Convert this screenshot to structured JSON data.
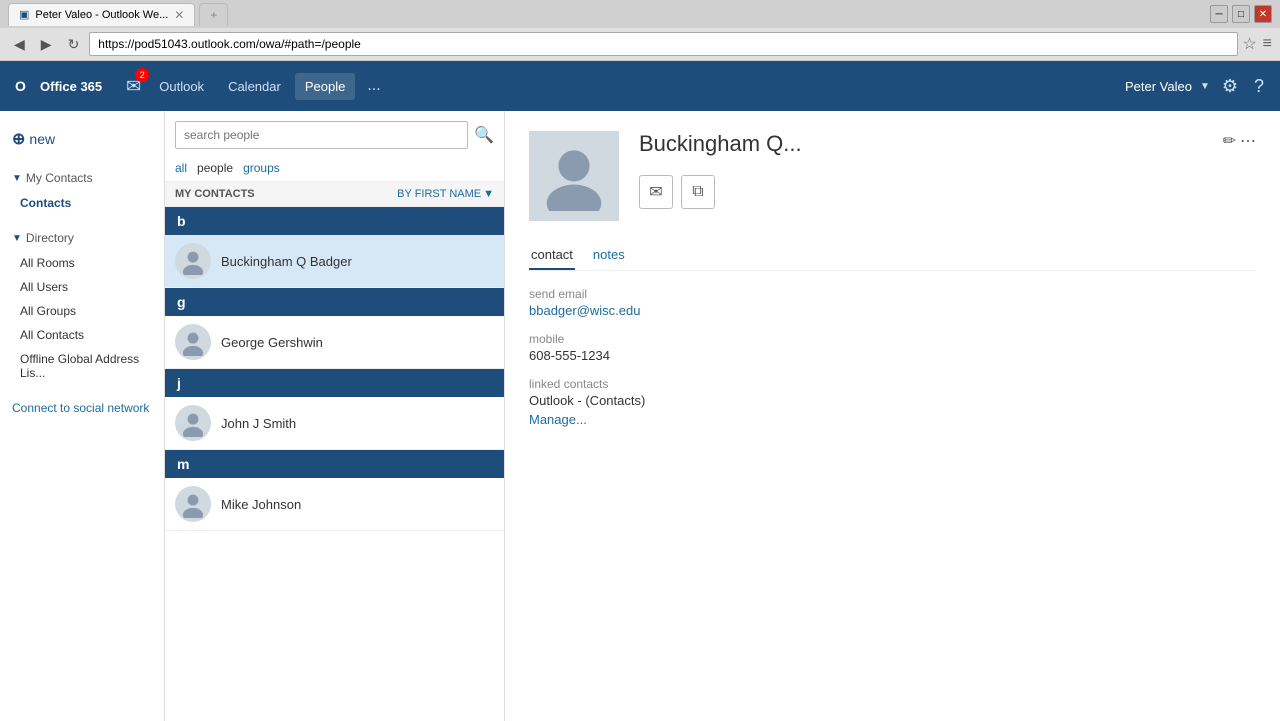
{
  "browser": {
    "tab_active": "Peter Valeo - Outlook We...",
    "tab_inactive": "",
    "address": "https://pod51043.outlook.com/owa/#path=/people",
    "back": "◀",
    "forward": "▶",
    "refresh": "↻"
  },
  "app": {
    "logo": "Office 365",
    "nav_items": [
      "Outlook",
      "Calendar",
      "People",
      "..."
    ],
    "user": "Peter Valeo",
    "mail_badge": "2"
  },
  "sidebar": {
    "new_label": "new",
    "my_contacts_label": "My Contacts",
    "contacts_label": "Contacts",
    "directory_label": "Directory",
    "all_rooms_label": "All Rooms",
    "all_users_label": "All Users",
    "all_groups_label": "All Groups",
    "all_contacts_label": "All Contacts",
    "offline_label": "Offline Global Address Lis...",
    "connect_label": "Connect to social network"
  },
  "contact_list": {
    "search_placeholder": "search people",
    "filter_all": "all",
    "filter_people": "people",
    "filter_groups": "groups",
    "section_label": "MY CONTACTS",
    "sort_label": "BY FIRST NAME",
    "contacts": [
      {
        "letter": "b",
        "name": "Buckingham Q Badger",
        "selected": true
      },
      {
        "letter": "g",
        "name": "George Gershwin",
        "selected": false
      },
      {
        "letter": "j",
        "name": "John J Smith",
        "selected": false
      },
      {
        "letter": "m",
        "name": "Mike Johnson",
        "selected": false
      }
    ]
  },
  "detail": {
    "name": "Buckingham Q...",
    "tab_contact": "contact",
    "tab_notes": "notes",
    "send_email_label": "send email",
    "send_email_value": "bbadger@wisc.edu",
    "mobile_label": "mobile",
    "mobile_value": "608-555-1234",
    "linked_contacts_label": "linked contacts",
    "linked_contacts_value": "Outlook - (Contacts)",
    "manage_label": "Manage..."
  }
}
